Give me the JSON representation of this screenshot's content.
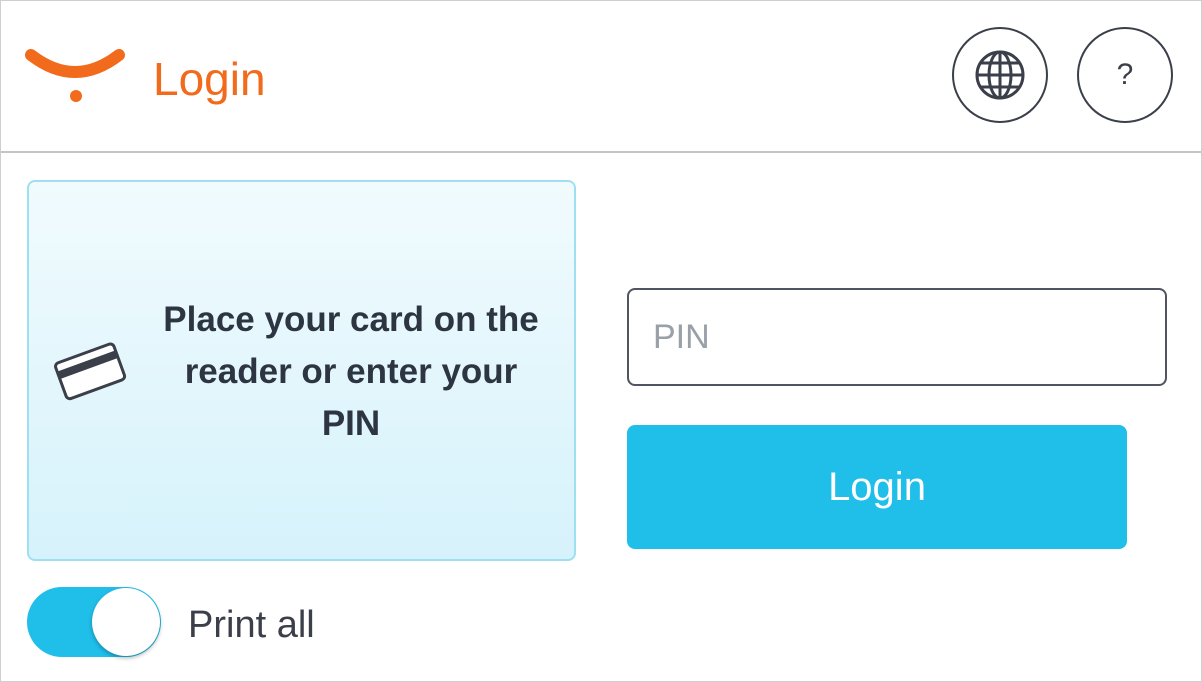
{
  "header": {
    "title": "Login",
    "logo_icon": "smile-logo-icon",
    "language_icon": "globe-icon",
    "help_label": "?"
  },
  "card_panel": {
    "icon": "credit-card-icon",
    "message": "Place your card on the reader or enter your PIN"
  },
  "pin": {
    "placeholder": "PIN",
    "value": ""
  },
  "login_button": {
    "label": "Login"
  },
  "print_all": {
    "label": "Print all",
    "enabled": true
  },
  "colors": {
    "brand": "#f26a1b",
    "accent": "#1fbfea",
    "text": "#2d3542",
    "panel_border": "#9fdff2"
  }
}
